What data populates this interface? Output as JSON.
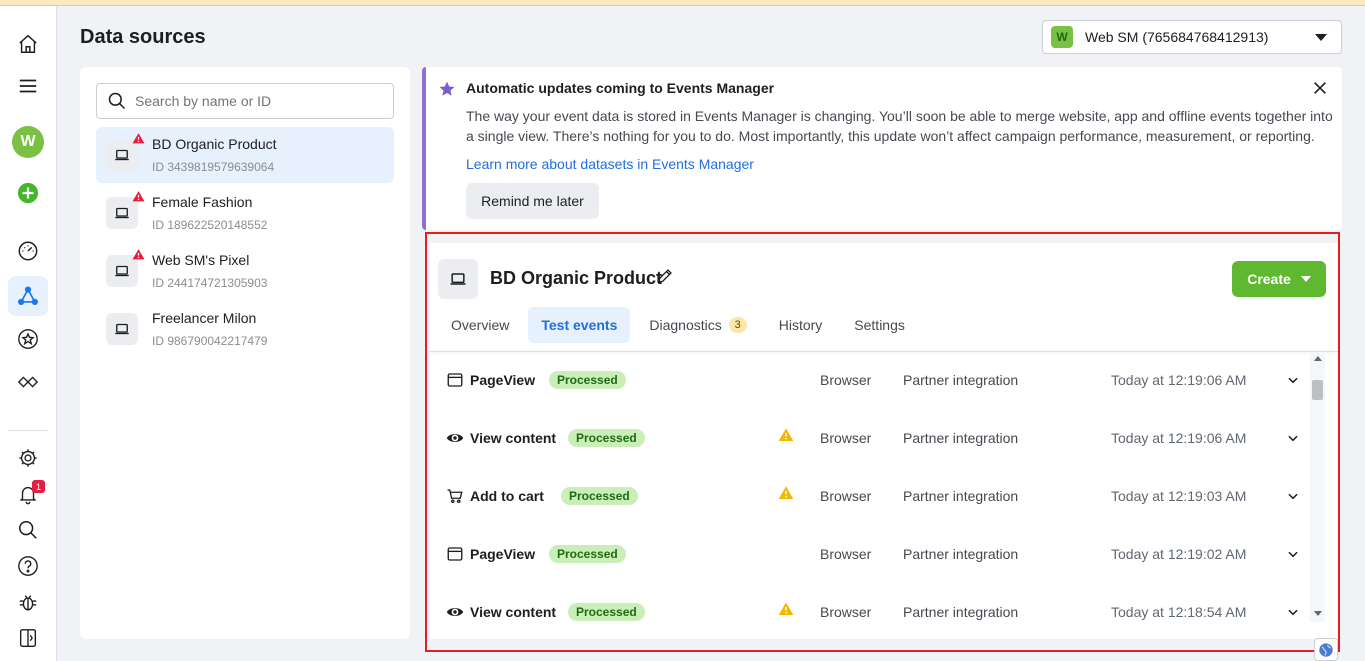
{
  "page": {
    "title": "Data sources"
  },
  "account": {
    "badge": "W",
    "name": "Web SM (765684768412913)"
  },
  "leftnav": {
    "avatar": "W",
    "notification_count": "1",
    "icons": [
      "home-icon",
      "menu-icon",
      "avatar",
      "add-icon",
      "dashboard-icon",
      "events-manager-icon",
      "star-icon",
      "handshake-icon",
      "settings-icon",
      "bell-icon",
      "search-icon",
      "help-icon",
      "bug-icon",
      "panel-icon"
    ]
  },
  "search": {
    "placeholder": "Search by name or ID"
  },
  "sources": [
    {
      "name": "BD Organic Product",
      "id": "ID 3439819579639064",
      "warning": true,
      "selected": true
    },
    {
      "name": "Female Fashion",
      "id": "ID 189622520148552",
      "warning": true,
      "selected": false
    },
    {
      "name": "Web SM's Pixel",
      "id": "ID 244174721305903",
      "warning": true,
      "selected": false
    },
    {
      "name": "Freelancer Milon",
      "id": "ID 986790042217479",
      "warning": false,
      "selected": false
    }
  ],
  "banner": {
    "title": "Automatic updates coming to Events Manager",
    "body": "The way your event data is stored in Events Manager is changing. You’ll soon be able to merge website, app and offline events together into a single view. There’s nothing for you to do. Most importantly, this update won’t affect campaign performance, measurement, or reporting.",
    "link": "Learn more about datasets in Events Manager",
    "remind_label": "Remind me later"
  },
  "dataset": {
    "title": "BD Organic Product",
    "create_label": "Create",
    "tabs": [
      {
        "label": "Overview",
        "active": false
      },
      {
        "label": "Test events",
        "active": true
      },
      {
        "label": "Diagnostics",
        "count": "3",
        "active": false
      },
      {
        "label": "History",
        "active": false
      },
      {
        "label": "Settings",
        "active": false
      }
    ]
  },
  "events": [
    {
      "icon": "page-icon",
      "name": "PageView",
      "status": "Processed",
      "warning": false,
      "source": "Browser",
      "method": "Partner integration",
      "time": "Today at 12:19:06 AM"
    },
    {
      "icon": "eye-icon",
      "name": "View content",
      "status": "Processed",
      "warning": true,
      "source": "Browser",
      "method": "Partner integration",
      "time": "Today at 12:19:06 AM"
    },
    {
      "icon": "cart-icon",
      "name": "Add to cart",
      "status": "Processed",
      "warning": true,
      "source": "Browser",
      "method": "Partner integration",
      "time": "Today at 12:19:03 AM"
    },
    {
      "icon": "page-icon",
      "name": "PageView",
      "status": "Processed",
      "warning": false,
      "source": "Browser",
      "method": "Partner integration",
      "time": "Today at 12:19:02 AM"
    },
    {
      "icon": "eye-icon",
      "name": "View content",
      "status": "Processed",
      "warning": true,
      "source": "Browser",
      "method": "Partner integration",
      "time": "Today at 12:18:54 AM"
    }
  ],
  "colors": {
    "accent": "#216fdb",
    "create_green": "#5fb830",
    "processed_bg": "#c9eeb8",
    "warning": "#f5b800",
    "error": "#e41e3f",
    "banner_border": "#8d6fd6",
    "highlight_box": "#e02020"
  }
}
